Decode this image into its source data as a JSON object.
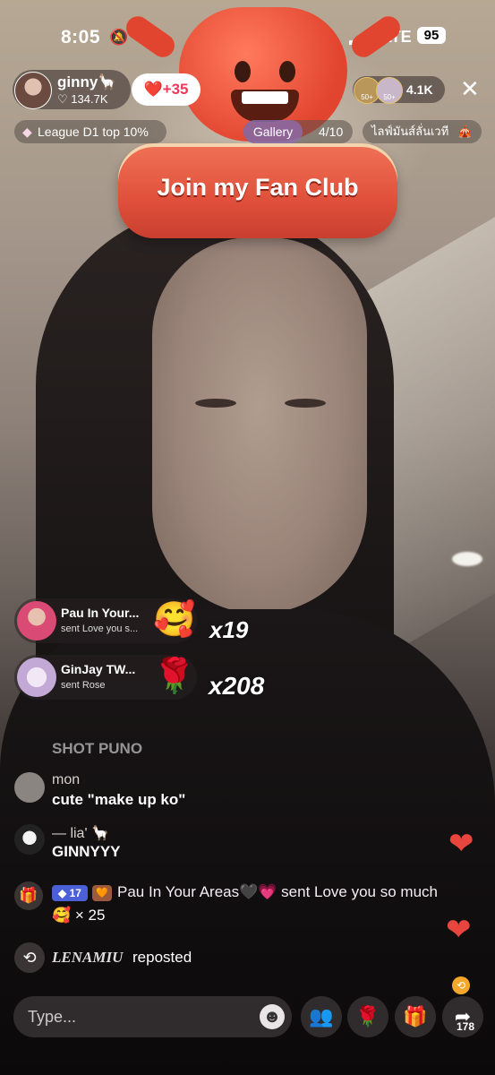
{
  "status_bar": {
    "time": "8:05",
    "network": "LTE",
    "battery": "95"
  },
  "host": {
    "name": "ginny🦙",
    "likes": "134.7K",
    "follow_label": "+35"
  },
  "top_right": {
    "viewers": "4.1K",
    "gifter1_label": "50+",
    "gifter2_label": "50+"
  },
  "fan_club": {
    "label": "Join my Fan Club"
  },
  "chips": {
    "league": "League D1 top 10%",
    "gallery_label": "Gallery",
    "gallery_count": "4/10",
    "explore_label": "ไลฟ์มันส์ลั่นเวที"
  },
  "gifts": [
    {
      "user": "Pau In Your...",
      "action": "sent Love you s...",
      "emoji": "🥰",
      "combo": "x19"
    },
    {
      "user": "GinJay TW...",
      "action": "sent Rose",
      "emoji": "🌹",
      "combo": "x208"
    }
  ],
  "chat": {
    "faded_message": "SHOT PUNO",
    "messages": [
      {
        "user": "mon",
        "text": "cute \"make up ko\""
      },
      {
        "user": "— lia' 🦙",
        "text": "GINNYYY"
      }
    ],
    "system_gift": {
      "level": "17",
      "text": "Pau In Your Areas🖤💗 sent Love you so much",
      "emoji": "🥰",
      "count": "× 25"
    },
    "repost": {
      "user": "LENAMIU",
      "action": "reposted"
    }
  },
  "bottom_bar": {
    "placeholder": "Type...",
    "share_count": "178"
  },
  "colors": {
    "accent": "#f0385a",
    "fan_club": "#e0503b",
    "heart": "#e8453f"
  }
}
